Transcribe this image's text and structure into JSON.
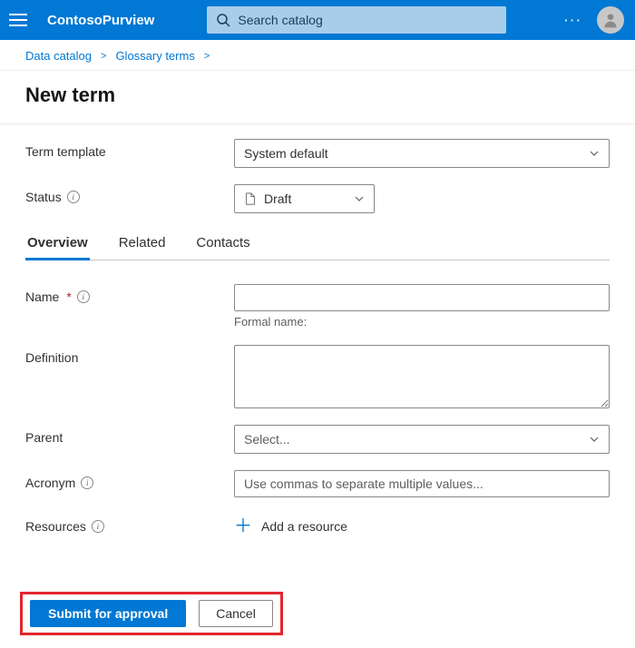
{
  "header": {
    "app_name": "ContosoPurview",
    "search_placeholder": "Search catalog",
    "more_label": "···"
  },
  "breadcrumb": {
    "items": [
      "Data catalog",
      "Glossary terms"
    ]
  },
  "page_title": "New term",
  "fields": {
    "template": {
      "label": "Term template",
      "value": "System default"
    },
    "status": {
      "label": "Status",
      "value": "Draft"
    },
    "name": {
      "label": "Name",
      "helper": "Formal name:"
    },
    "definition": {
      "label": "Definition"
    },
    "parent": {
      "label": "Parent",
      "placeholder": "Select..."
    },
    "acronym": {
      "label": "Acronym",
      "placeholder": "Use commas to separate multiple values..."
    },
    "resources": {
      "label": "Resources",
      "add_label": "Add a resource"
    }
  },
  "tabs": [
    "Overview",
    "Related",
    "Contacts"
  ],
  "footer": {
    "submit": "Submit for approval",
    "cancel": "Cancel"
  }
}
